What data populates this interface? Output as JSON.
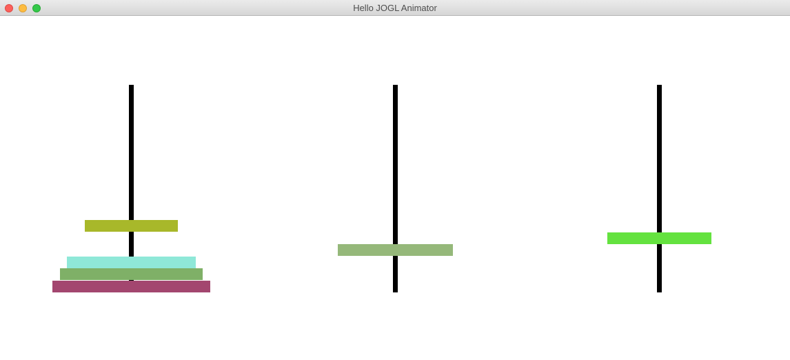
{
  "window": {
    "title": "Hello JOGL Animator",
    "buttons": [
      "close",
      "minimize",
      "zoom"
    ]
  },
  "scene": {
    "background": "#ffffff",
    "peg_color": "#000000",
    "pegs": [
      "peg-1",
      "peg-2",
      "peg-3"
    ],
    "disks": [
      {
        "name": "disk-olive",
        "color": "#a8b82a",
        "peg": 1
      },
      {
        "name": "disk-turquoise",
        "color": "#8fe8d8",
        "peg": 1
      },
      {
        "name": "disk-green",
        "color": "#7fb067",
        "peg": 1
      },
      {
        "name": "disk-magenta",
        "color": "#a3466f",
        "peg": 1
      },
      {
        "name": "disk-sage",
        "color": "#95b87a",
        "peg": 2
      },
      {
        "name": "disk-lime",
        "color": "#64e23f",
        "peg": 3
      }
    ]
  }
}
